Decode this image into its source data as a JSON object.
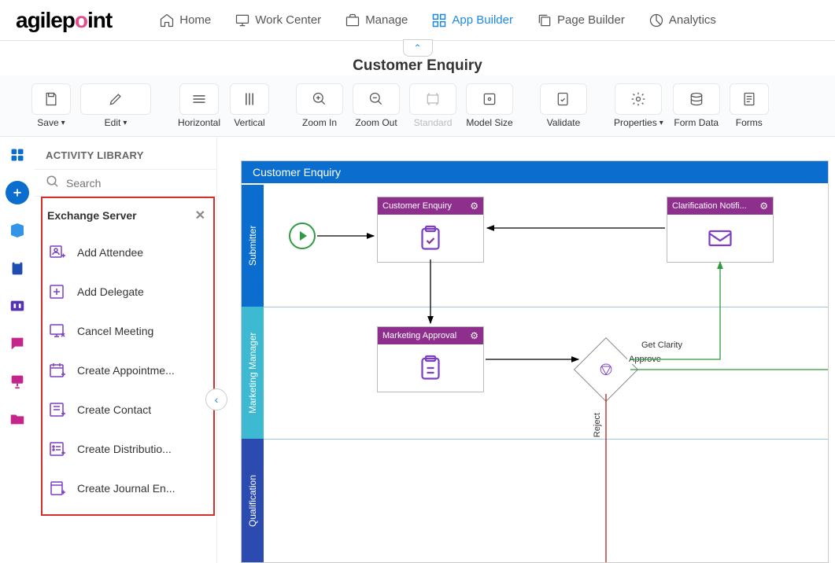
{
  "brand": "agilepoint",
  "nav": {
    "home": "Home",
    "work_center": "Work Center",
    "manage": "Manage",
    "app_builder": "App Builder",
    "page_builder": "Page Builder",
    "analytics": "Analytics"
  },
  "page_title": "Customer Enquiry",
  "toolbar": {
    "save": "Save",
    "edit": "Edit",
    "horizontal": "Horizontal",
    "vertical": "Vertical",
    "zoom_in": "Zoom In",
    "zoom_out": "Zoom Out",
    "standard": "Standard",
    "model_size": "Model Size",
    "validate": "Validate",
    "properties": "Properties",
    "form_data": "Form Data",
    "forms": "Forms"
  },
  "sidepanel": {
    "title": "ACTIVITY LIBRARY",
    "search_placeholder": "Search",
    "group_title": "Exchange Server",
    "activities": [
      "Add Attendee",
      "Add Delegate",
      "Cancel Meeting",
      "Create Appointme...",
      "Create Contact",
      "Create Distributio...",
      "Create Journal En..."
    ]
  },
  "canvas": {
    "title": "Customer Enquiry",
    "lanes": {
      "submitter": "Submitter",
      "marketing": "Marketing Manager",
      "qualification": "Qualification"
    },
    "nodes": {
      "customer_enquiry": "Customer Enquiry",
      "clarification": "Clarification Notifi...",
      "marketing_approval": "Marketing Approval"
    },
    "edges": {
      "get_clarity": "Get Clarity",
      "approve": "Approve",
      "reject": "Reject"
    }
  }
}
